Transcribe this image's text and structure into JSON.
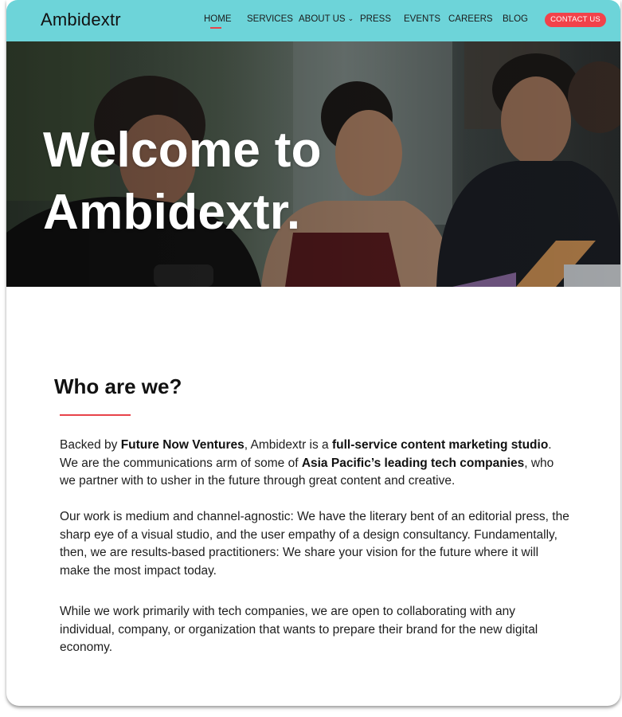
{
  "brand": {
    "logo": "Ambidextr",
    "accent": "#6dd4d9",
    "cta_color": "#f2424a",
    "rule_color": "#e8434a"
  },
  "nav": {
    "items": [
      {
        "label": "HOME",
        "active": true
      },
      {
        "label": "SERVICES"
      },
      {
        "label": "ABOUT US",
        "dropdown_icon": "chevron-down-icon"
      },
      {
        "label": "PRESS"
      },
      {
        "label": "EVENTS"
      },
      {
        "label": "CAREERS"
      },
      {
        "label": "BLOG"
      }
    ],
    "cta": "CONTACT US"
  },
  "hero": {
    "title_line1": "Welcome to",
    "title_line2": "Ambidextr."
  },
  "about": {
    "heading": "Who are we?",
    "p1": {
      "t1": "Backed by ",
      "b1": "Future Now Ventures",
      "t2": ", Ambidextr is a ",
      "b2": "full-service content marketing studio",
      "t3": ". We are the communications arm of some of ",
      "b3": "Asia Pacific’s leading tech companies",
      "t4": ", who we partner with to usher in the future through great content and creative."
    },
    "p2": "Our work is medium and channel-agnostic: We have the literary bent of an editorial press, the sharp eye of a visual studio, and the user empathy of a design consultancy. Fundamentally, then, we are results-based practitioners: We share your vision for the future where it will make the most impact today.",
    "p3": "While we work primarily with tech companies, we are open to collaborating with any individual, company, or organization that wants to prepare their brand for the new digital economy."
  }
}
